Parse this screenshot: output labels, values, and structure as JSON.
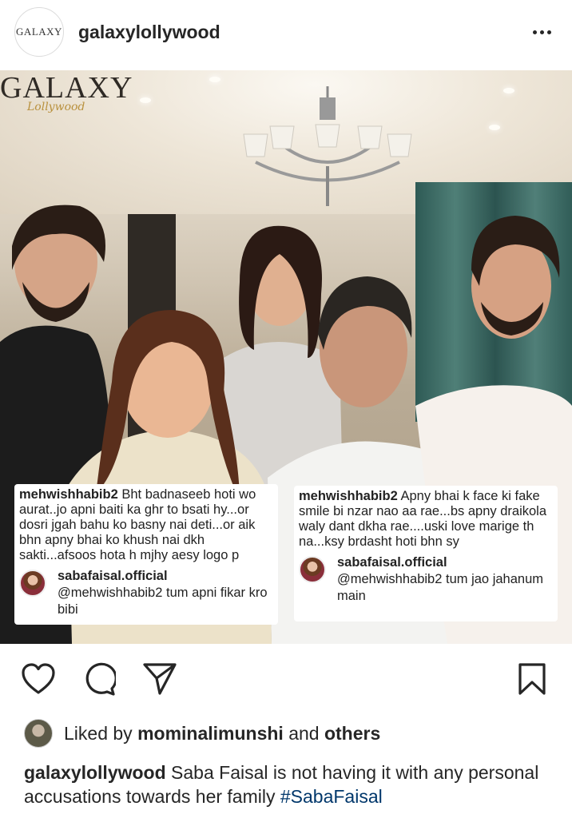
{
  "header": {
    "avatar_text": "GALAXY",
    "username": "galaxylollywood",
    "more_icon": "more-horizontal-icon"
  },
  "photo": {
    "logo_main": "GALAXY",
    "logo_sub": "Lollywood",
    "comments": [
      {
        "user": "mehwishhabib2",
        "text": "Bht badnaseeb hoti wo aurat..jo apni baiti ka ghr to bsati hy...or dosri jgah bahu ko basny nai deti...or aik bhn apny bhai ko khush nai dkh sakti...afsoos hota h mjhy aesy logo p",
        "reply_user": "sabafaisal.official",
        "reply_mention": "@mehwishhabib2",
        "reply_text": "tum apni fikar kro bibi"
      },
      {
        "user": "mehwishhabib2",
        "text": "Apny bhai k face ki fake smile bi nzar nao aa rae...bs apny draikola waly dant dkha rae....uski love marige th na...ksy brdasht hoti bhn sy",
        "reply_user": "sabafaisal.official",
        "reply_mention": "@mehwishhabib2",
        "reply_text": "tum jao jahanum main"
      }
    ]
  },
  "actions": {
    "like_icon": "heart-icon",
    "comment_icon": "comment-icon",
    "share_icon": "send-icon",
    "save_icon": "bookmark-icon"
  },
  "likes": {
    "prefix": "Liked by",
    "user": "mominalimunshi",
    "connector": "and",
    "suffix": "others"
  },
  "caption": {
    "user": "galaxylollywood",
    "text": "Saba Faisal is not having it with any personal accusations towards her family",
    "hashtag": "#SabaFaisal"
  }
}
